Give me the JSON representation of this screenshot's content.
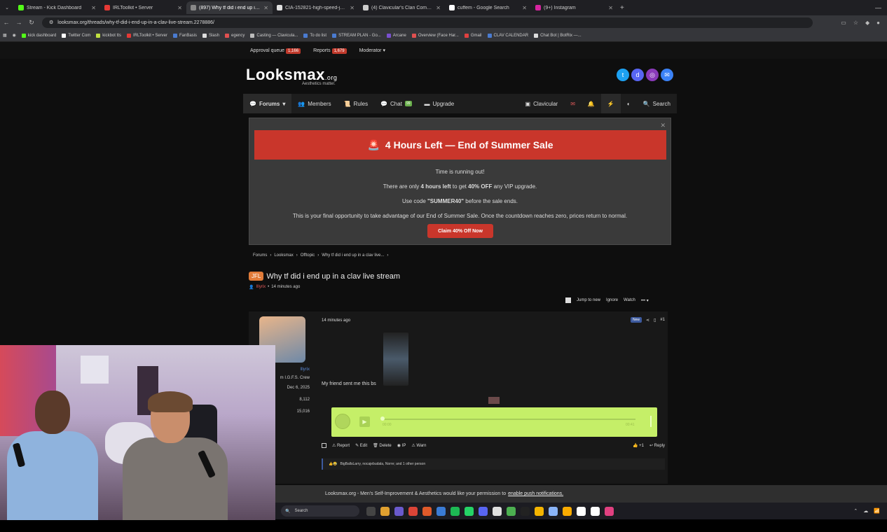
{
  "tabs": [
    {
      "title": "Stream - Kick Dashboard",
      "color": "#53fc18",
      "active": false
    },
    {
      "title": "IRLToolkit • Server",
      "color": "#e53935",
      "active": false
    },
    {
      "title": "(897) Why tf did i end up in a cl",
      "color": "#888888",
      "active": true
    },
    {
      "title": "CIA-152821-high-speed-jaw-ap",
      "color": "#e0e0e0",
      "active": false
    },
    {
      "title": "(4) Clavicular's Clan Communit",
      "color": "#cccccc",
      "active": false
    },
    {
      "title": "cuffem - Google Search",
      "color": "#ffffff",
      "active": false
    },
    {
      "title": "(9+) Instagram",
      "color": "#d6249f",
      "active": false
    }
  ],
  "address": {
    "url": "looksmax.org/threads/why-tf-did-i-end-up-in-a-clav-live-stream.2278886/"
  },
  "bookmarks": [
    {
      "label": "kick dashboard",
      "color": "#53fc18"
    },
    {
      "label": "Twitter Com",
      "color": "#ffffff"
    },
    {
      "label": "kickbot tts",
      "color": "#c0e040"
    },
    {
      "label": "IRLToolkit • Server",
      "color": "#e53935"
    },
    {
      "label": "FanBasis",
      "color": "#4a7bd0"
    },
    {
      "label": "Slash",
      "color": "#dddddd"
    },
    {
      "label": "egency",
      "color": "#e05050"
    },
    {
      "label": "Casting — Clavicula...",
      "color": "#bbbbbb"
    },
    {
      "label": "To do list",
      "color": "#4a7bd0"
    },
    {
      "label": "STREAM PLAN - Go...",
      "color": "#4a7bd0"
    },
    {
      "label": "Arcane",
      "color": "#7a50d0"
    },
    {
      "label": "Overview (Face Har...",
      "color": "#e05050"
    },
    {
      "label": "Gmail",
      "color": "#e04040"
    },
    {
      "label": "CLAV CALENDAR",
      "color": "#4a7bd0"
    },
    {
      "label": "Chat Bot | BotRix —...",
      "color": "#dddddd"
    }
  ],
  "modbar": {
    "approval": "Approval queue",
    "approval_count": "1,166",
    "reports": "Reports",
    "reports_count": "1,679",
    "moderator": "Moderator ▾"
  },
  "logo": {
    "main": "Looksmax",
    "tld": ".org",
    "tagline": "Aesthetics matter."
  },
  "social_colors": [
    "#1da1f2",
    "#5865f2",
    "#8a3ab9",
    "#3b82f6"
  ],
  "nav": {
    "forums": "Forums",
    "members": "Members",
    "rules": "Rules",
    "chat": "Chat",
    "chat_badge": "99",
    "upgrade": "Upgrade",
    "user": "Clavicular",
    "search": "Search"
  },
  "promo": {
    "headline": "4 Hours Left — End of Summer Sale",
    "line1": "Time is running out!",
    "line2_a": "There are only ",
    "line2_b": "4 hours left",
    "line2_c": " to get ",
    "line2_d": "40% OFF",
    "line2_e": " any VIP upgrade.",
    "line3_a": "Use code ",
    "line3_b": "\"SUMMER40\"",
    "line3_c": " before the sale ends.",
    "line4": "This is your final opportunity to take advantage of our End of Summer Sale. Once the countdown reaches zero, prices return to normal.",
    "cta": "Claim 40% Off Now"
  },
  "breadcrumbs": [
    "Forums",
    "Looksmax",
    "Offtopic",
    "Why tf did i end up in a clav live..."
  ],
  "thread": {
    "prefix": "JFL",
    "title": "Why tf did i end up in a clav live stream",
    "author": "Illyrix",
    "time": "14 minutes ago"
  },
  "thread_actions": {
    "jump": "Jump to new",
    "ignore": "Ignore",
    "watch": "Watch",
    "more": "••• ▾"
  },
  "post": {
    "time": "14 minutes ago",
    "new_badge": "New",
    "number": "#1",
    "author_name": "Illyrix",
    "author_title": "m I.G.F.S. Crew",
    "joined": "Dec 6, 2025",
    "posts": "8,112",
    "reputation": "15,016",
    "text": "My friend sent me this bs",
    "audio_start": "00:00",
    "audio_end": "00:41",
    "actions": {
      "report": "Report",
      "edit": "Edit",
      "delete": "Delete",
      "ip": "IP",
      "warn": "Warn"
    },
    "like": "+1",
    "reply": "Reply",
    "reactions": "BigBallsLarry, nocajebudala, Norre; and 1 other person"
  },
  "push": {
    "text": "Looksmax.org - Men's Self-Improvement & Aesthetics would like your permission to",
    "link": "enable push notifications."
  },
  "taskbar": {
    "search": "Search",
    "app_colors": [
      "#444",
      "#e0a030",
      "#6a5acd",
      "#db4437",
      "#e05a2a",
      "#3a7bd5",
      "#1db954",
      "#25d366",
      "#5865f2",
      "#e0e0e0",
      "#4caf50",
      "#222",
      "#f4b400",
      "#8ab4f8",
      "#f9ab00",
      "#ffffff",
      "#ffffff",
      "#e04080"
    ]
  }
}
